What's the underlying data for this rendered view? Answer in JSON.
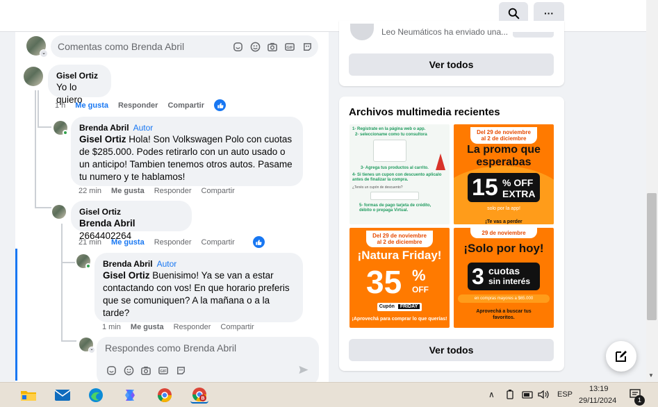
{
  "top": {
    "search_icon": "search-icon",
    "more_label": "···"
  },
  "notification_preview": {
    "text": "Leo Neumáticos ha enviado una..."
  },
  "comment_box": {
    "placeholder": "Comentas como Brenda Abril"
  },
  "comments": [
    {
      "author": "Gisel Ortiz",
      "text": "Yo lo quiero",
      "time": "1 h",
      "like": "Me gusta",
      "reply": "Responder",
      "share": "Compartir"
    },
    {
      "author": "Brenda Abril",
      "tag": "Autor",
      "mention": "Gisel Ortiz",
      "text": " Hola! Son Volkswagen Polo con cuotas de $285.000. Podes retirarlo con un auto usado o un anticipo! Tambien tenemos otros autos. Pasame tu numero y te hablamos!",
      "time": "22 min",
      "like": "Me gusta",
      "reply": "Responder",
      "share": "Compartir"
    },
    {
      "author": "Gisel Ortiz",
      "mention": "Brenda Abril",
      "text": " 2664402264",
      "time": "21 min",
      "like": "Me gusta",
      "reply": "Responder",
      "share": "Compartir"
    },
    {
      "author": "Brenda Abril",
      "tag": "Autor",
      "mention": "Gisel Ortiz",
      "text": " Buenisimo! Ya se van a estar contactando con vos! En que horario preferis que se comuniquen? A la mañana o a la tarde?",
      "time": "1 min",
      "like": "Me gusta",
      "reply": "Responder",
      "share": "Compartir"
    }
  ],
  "reply_box": {
    "placeholder": "Respondes como Brenda Abril"
  },
  "sidebar": {
    "see_all_1": "Ver todos",
    "media_title": "Archivos multimedia recientes",
    "see_all_2": "Ver todos",
    "media": [
      {
        "steps": [
          "1- Registrate en la página web o app.",
          "2- seleccioname como tu consultora",
          "3- Agrega tus productos al carrito.",
          "4- Si tienes un cupon con descuento aplicalo antes de finalizar la compra.",
          "¿Tenés un cupón de descuento?",
          "5- formas de pago tarjeta de crédito, débito o prepaga Virtual."
        ]
      },
      {
        "date_1": "Del 29 de noviembre",
        "date_2": "al 2 de diciembre",
        "headline": "La promo que esperabas",
        "big": "15",
        "pct_off": "% OFF",
        "extra": "EXTRA",
        "note": "solo por la app!",
        "footer": "¡Te vas a perder"
      },
      {
        "date_1": "Del 29 de noviembre",
        "date_2": "al 2 de diciembre",
        "headline": "¡Natura Friday!",
        "big": "35",
        "pct": "%",
        "off": "OFF",
        "coupon": "Cupón",
        "coupon_code": "FRIDAY",
        "footer": "¡Aprovechá para comprar lo que querías!"
      },
      {
        "date": "29 de noviembre",
        "headline": "¡Solo por hoy!",
        "big": "3",
        "cuotas": "cuotas",
        "interest": "sin interés",
        "min": "en compras mayores a $65.000",
        "footer": "Aprovechá a buscar tus favoritos."
      }
    ]
  },
  "taskbar": {
    "lang": "ESP",
    "time": "13:19",
    "date": "29/11/2024",
    "notif_count": "1"
  },
  "colors": {
    "accent": "#1877f2",
    "promo_orange": "#ff7a00"
  }
}
